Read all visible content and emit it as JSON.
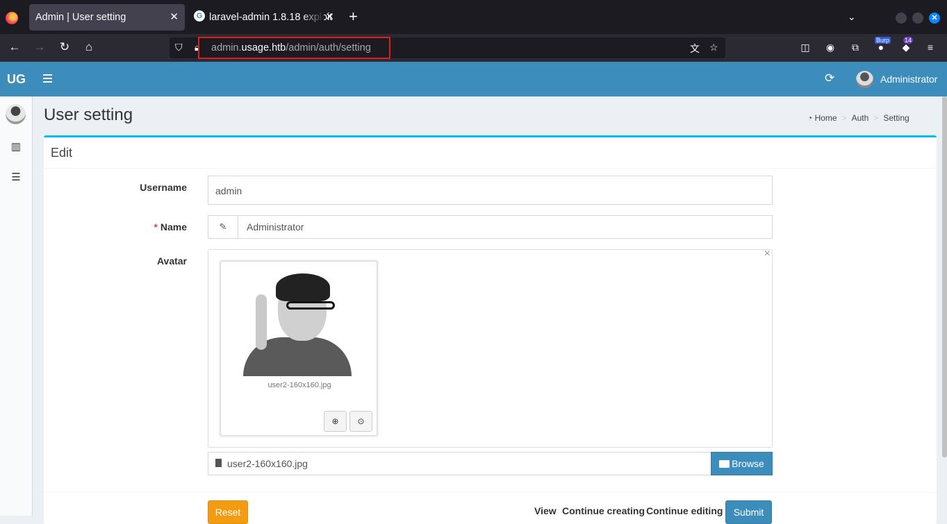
{
  "browser": {
    "tabs": [
      {
        "title": "Admin | User setting"
      },
      {
        "title": "laravel-admin 1.8.18 exploit"
      }
    ],
    "url": {
      "prefix": "admin.",
      "domain": "usage.htb",
      "path": "/admin/auth/setting"
    },
    "badges": {
      "burp": "Burp",
      "ext_count": "14"
    }
  },
  "app": {
    "logo": "UG",
    "user_name": "Administrator"
  },
  "page": {
    "title": "User setting",
    "breadcrumb": [
      "Home",
      "Auth",
      "Setting"
    ]
  },
  "form": {
    "box_title": "Edit",
    "username_label": "Username",
    "username_value": "admin",
    "name_required_mark": "*",
    "name_label": "Name",
    "name_value": "Administrator",
    "avatar_label": "Avatar",
    "avatar_filename": "user2-160x160.jpg",
    "file_input_value": "user2-160x160.jpg",
    "browse_label": "Browse",
    "reset_label": "Reset",
    "view_label": "View",
    "continue_creating_label": "Continue creating",
    "continue_editing_label": "Continue editing",
    "submit_label": "Submit"
  }
}
